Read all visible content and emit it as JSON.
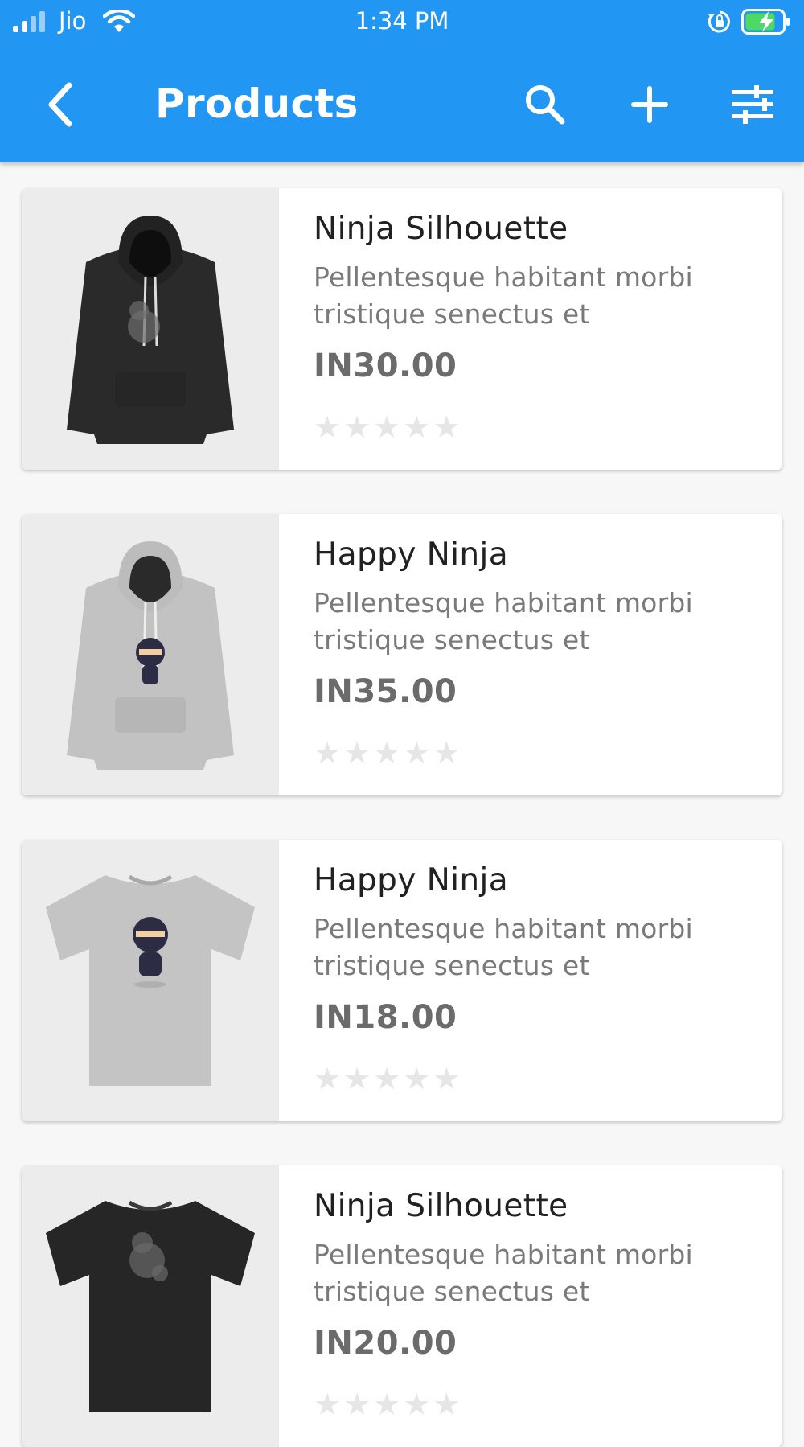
{
  "status_bar": {
    "carrier": "Jio",
    "time": "1:34 PM",
    "signal_icon": "signal-bars-icon",
    "wifi_icon": "wifi-icon",
    "rotation_lock_icon": "rotation-lock-icon",
    "battery_icon": "battery-charging-icon"
  },
  "app_bar": {
    "title": "Products",
    "back_icon": "chevron-left-icon",
    "search_icon": "search-icon",
    "add_icon": "plus-icon",
    "filter_icon": "sliders-icon",
    "color": "#2196f3"
  },
  "products": [
    {
      "name": "Ninja Silhouette",
      "description": "Pellentesque habitant morbi tristique senectus et",
      "price": "IN30.00",
      "rating": 0,
      "image": "black-hoodie"
    },
    {
      "name": "Happy Ninja",
      "description": "Pellentesque habitant morbi tristique senectus et",
      "price": "IN35.00",
      "rating": 0,
      "image": "grey-hoodie"
    },
    {
      "name": "Happy Ninja",
      "description": "Pellentesque habitant morbi tristique senectus et",
      "price": "IN18.00",
      "rating": 0,
      "image": "grey-tshirt"
    },
    {
      "name": "Ninja Silhouette",
      "description": "Pellentesque habitant morbi tristique senectus et",
      "price": "IN20.00",
      "rating": 0,
      "image": "black-tshirt"
    }
  ]
}
